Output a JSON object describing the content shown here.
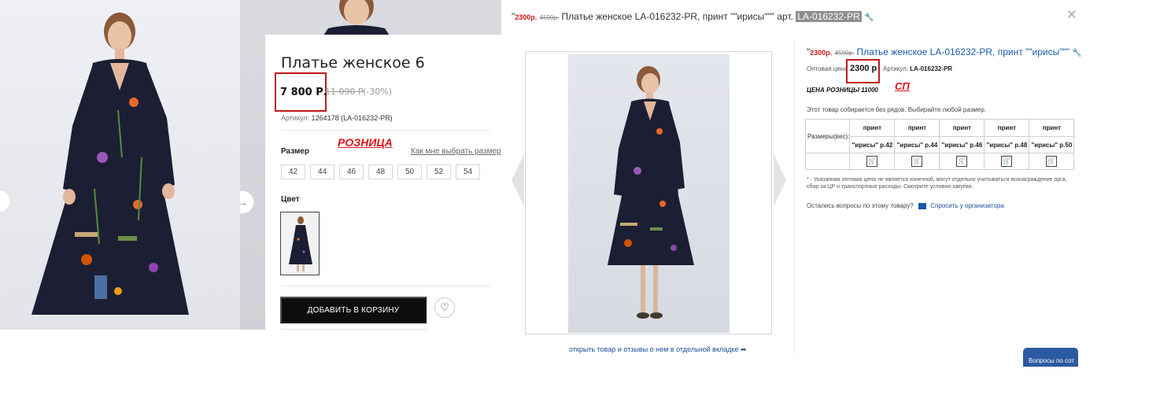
{
  "retail": {
    "product_title": "Платье женское 6",
    "price": "7 800 Р.",
    "old_price": "11 090 Р",
    "discount": "(-30%)",
    "sku_label": "Артикул:",
    "sku_value": "1264178 (LA-016232-PR)",
    "size_label": "Размер",
    "size_help": "Как мне выбрать размер",
    "sizes": [
      "42",
      "44",
      "46",
      "48",
      "50",
      "52",
      "54"
    ],
    "color_label": "Цвет",
    "add_to_cart": "ДОБАВИТЬ В КОРЗИНУ",
    "annotation": "РОЗНИЦА",
    "fav_icon": "heart-icon",
    "next_icon": "arrow-right-icon"
  },
  "sp": {
    "title": {
      "quote_open": "\"",
      "price": "2300р.",
      "old_price": "4590р.",
      "name": "Платье женское LA-016232-PR, принт \"\"ирисы\"\"\"",
      "art_prefix": "арт.",
      "art_value": "LA-016232-PR"
    },
    "detail_title": {
      "quote_open": "\"",
      "price": "2300р.",
      "old_price": "4590р.",
      "name": "Платье женское LA-016232-PR, принт \"\"ирисы\"\"\""
    },
    "wholesale_label": "Оптовая цена",
    "wholesale_price": "2300 р",
    "article_label": "Артикул:",
    "article_value": "LA-016232-PR",
    "annotation": "СП",
    "retail_price": "ЦЕНА РОЗНИЦЫ 11000",
    "collect_note": "Этот товар собирается без рядов. Выбирайте любой размер.",
    "sizes_label": "Размеры(вес):",
    "size_columns": [
      {
        "top": "принт",
        "bottom": "\"ирисы\" р.42"
      },
      {
        "top": "принт",
        "bottom": "\"ирисы\" р.44"
      },
      {
        "top": "принт",
        "bottom": "\"ирисы\" р.46"
      },
      {
        "top": "принт",
        "bottom": "\"ирисы\" р.48"
      },
      {
        "top": "принт",
        "bottom": "\"ирисы\" р.50"
      }
    ],
    "footnote": "* - Указанная оптовая цена не является конечной, могут отдельно учитываться вознаграждение орга, сбор за ЦР и транспортные расходы. Смотрите условия закупки.",
    "question": "Остались вопросы по этому товару?",
    "ask_link": "Спросить у организатора",
    "open_link": "открыть товар и отзывы о нем в отдельной вкладке",
    "close_icon": "×",
    "chat_tab": "Вопросы по сот"
  },
  "colors": {
    "accent_red": "#c41a1a",
    "link_blue": "#1a5aa8",
    "dress_navy": "#1c1f33"
  }
}
